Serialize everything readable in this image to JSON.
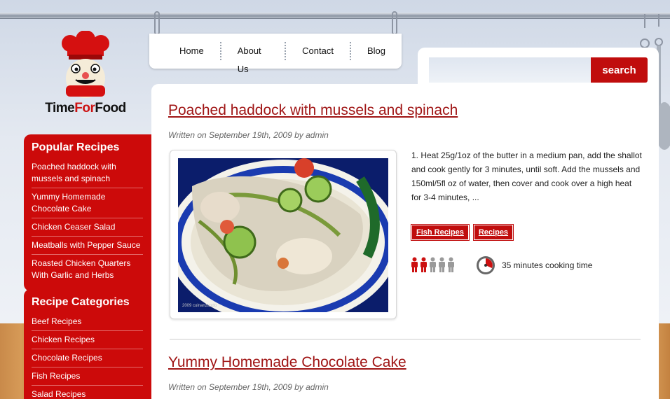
{
  "logo": {
    "part1": "Time",
    "part2": "For",
    "part3": "Food"
  },
  "nav": [
    "Home",
    "About Us",
    "Contact",
    "Blog"
  ],
  "search": {
    "placeholder": "",
    "button": "search"
  },
  "sidebar": {
    "popular": {
      "title": "Popular Recipes",
      "items": [
        "Poached haddock with mussels and spinach",
        "Yummy Homemade Chocolate Cake",
        "Chicken Ceaser Salad",
        "Meatballs with Pepper Sauce",
        "Roasted Chicken Quarters With Garlic and Herbs"
      ]
    },
    "categories": {
      "title": "Recipe Categories",
      "items": [
        "Beef Recipes",
        "Chicken Recipes",
        "Chocolate Recipes",
        "Fish Recipes",
        "Salad Recipes"
      ]
    }
  },
  "posts": [
    {
      "title": "Poached haddock with mussels and spinach",
      "meta": "Written on September 19th, 2009 by admin",
      "photo_caption": "2009 cuinanzando",
      "excerpt": "1. Heat 25g/1oz of the butter in a medium pan, add the shallot and cook gently for 3 minutes, until soft. Add the mussels and 150ml/5fl oz of water, then cover and cook over a high heat for 3-4 minutes, ...",
      "tags": [
        "Fish Recipes",
        "Recipes"
      ],
      "difficulty": {
        "filled": 2,
        "total": 5
      },
      "cook_time": "35 minutes cooking time"
    },
    {
      "title": "Yummy Homemade Chocolate Cake",
      "meta": "Written on September 19th, 2009 by admin"
    }
  ],
  "colors": {
    "accent": "#cc0a0a",
    "title": "#a01515"
  }
}
